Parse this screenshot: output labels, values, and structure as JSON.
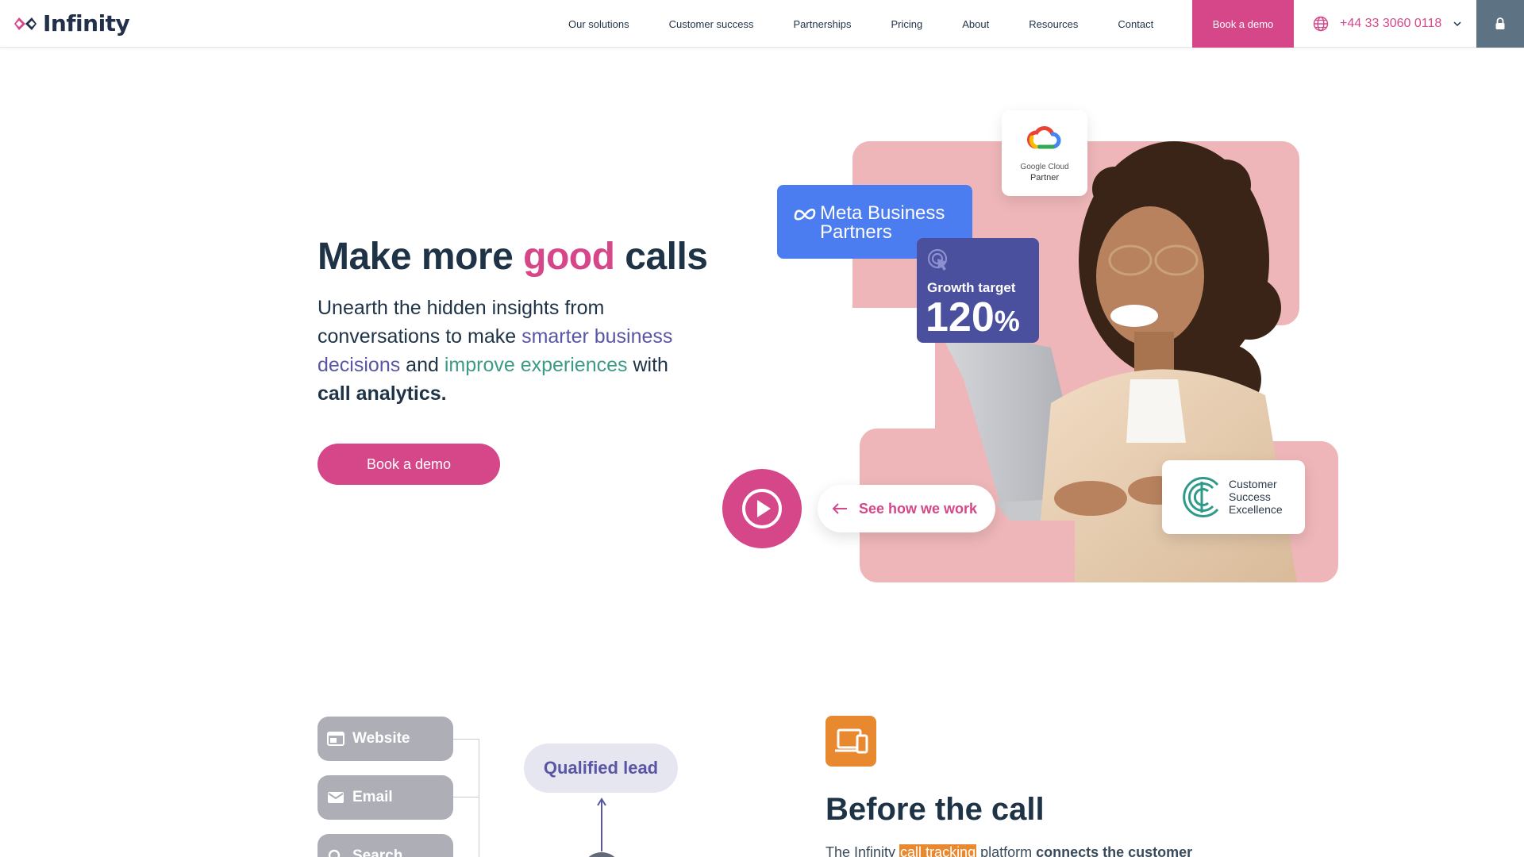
{
  "brand": {
    "name": "Infinity"
  },
  "nav": {
    "items": [
      "Our solutions",
      "Customer success",
      "Partnerships",
      "Pricing",
      "About",
      "Resources",
      "Contact"
    ],
    "cta": "Book a demo",
    "phone": "+44 33 3060 0118"
  },
  "hero": {
    "title_part1": "Make more ",
    "title_highlight": "good",
    "title_part2": " calls",
    "sub_part1": "Unearth the hidden insights from conversations to make ",
    "sub_highlight1": "smarter business decisions",
    "sub_part2": " and ",
    "sub_highlight2": "improve experiences",
    "sub_part3": " with ",
    "sub_bold": "call analytics.",
    "cta": "Book a demo"
  },
  "badges": {
    "google_cloud_name": "Google Cloud",
    "google_cloud_partner": "Partner",
    "meta_line1": "Meta Business",
    "meta_line2": "Partners",
    "growth_label": "Growth target",
    "growth_value": "120",
    "growth_unit": "%",
    "cse_line1": "Customer",
    "cse_line2": "Success",
    "cse_line3": "Excellence"
  },
  "video": {
    "see_how": "See how we work"
  },
  "flow": {
    "sources": [
      "Website",
      "Email",
      "Search"
    ],
    "qualified": "Qualified lead"
  },
  "before_call": {
    "title": "Before the call",
    "text_part1": "The Infinity ",
    "text_highlight": "call tracking",
    "text_part2": " platform ",
    "text_bold": "connects the customer"
  },
  "colors": {
    "brand_pink": "#d6478a",
    "brand_navy": "#1f3347",
    "purple": "#5a56a6",
    "teal": "#3d9a85",
    "meta_blue": "#4c7df0",
    "growth_indigo": "#4a4f9e",
    "orange": "#e8892f",
    "hero_pink_bg": "#eeb6b8"
  }
}
